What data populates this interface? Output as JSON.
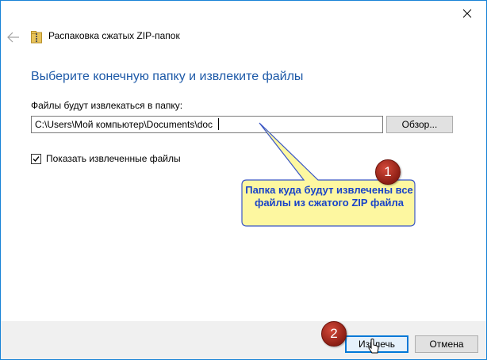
{
  "window": {
    "title": "Распаковка сжатых ZIP-папок",
    "close_icon": "close-icon",
    "back_icon": "back-arrow-icon",
    "zip_icon": "zip-folder-icon"
  },
  "main": {
    "heading": "Выберите конечную папку и извлеките файлы",
    "field_label": "Файлы будут извлекаться в папку:",
    "path_value": "C:\\Users\\Мой компьютер\\Documents\\doc",
    "browse_label": "Обзор...",
    "show_files_label": "Показать извлеченные файлы",
    "show_files_checked": true
  },
  "annotations": {
    "callout_text": "Папка куда будут извлечены все файлы из сжатого ZIP файла",
    "step1": "1",
    "step2": "2",
    "callout_fill": "#fdf7a0",
    "callout_border": "#3a56c5",
    "badge_color": "#a52a1e"
  },
  "footer": {
    "extract_label": "Извлечь",
    "cancel_label": "Отмена"
  },
  "colors": {
    "accent": "#0078d7",
    "heading": "#1e5aa8",
    "footer_bg": "#f0f0f0"
  }
}
